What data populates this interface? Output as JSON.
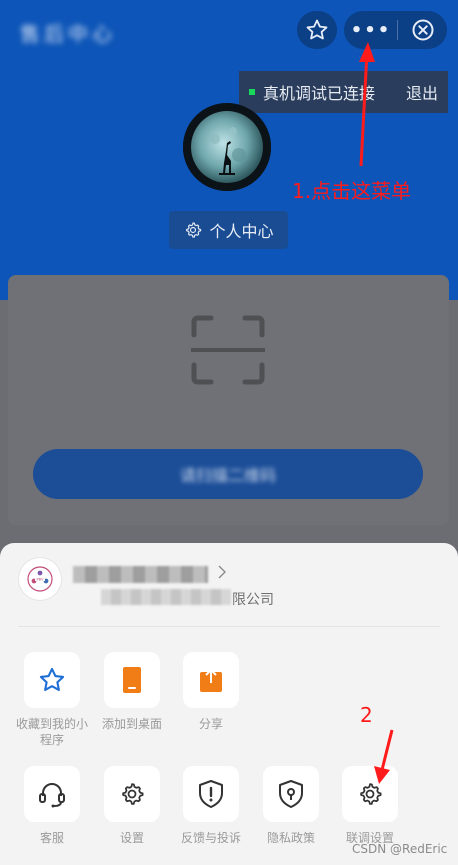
{
  "header": {
    "title": "售后中心",
    "debug_status": "真机调试已连接",
    "debug_exit": "退出",
    "capsule_more": "•••",
    "profile_button": "个人中心"
  },
  "card": {
    "scan_button": "请扫描二维码"
  },
  "sheet": {
    "mini_program_name": "",
    "company_suffix": "限公司",
    "row1": [
      {
        "label": "收藏到我的小程序",
        "icon": "star-icon"
      },
      {
        "label": "添加到桌面",
        "icon": "phone-icon"
      },
      {
        "label": "分享",
        "icon": "share-icon"
      }
    ],
    "row2": [
      {
        "label": "客服",
        "icon": "headset-icon"
      },
      {
        "label": "设置",
        "icon": "gear-icon"
      },
      {
        "label": "反馈与投诉",
        "icon": "warning-shield-icon"
      },
      {
        "label": "隐私政策",
        "icon": "privacy-shield-icon"
      },
      {
        "label": "联调设置",
        "icon": "gear-icon"
      }
    ]
  },
  "annotations": {
    "step1": "1.点击这菜单",
    "step2": "2"
  },
  "watermark": "CSDN @RedEric",
  "colors": {
    "brand_blue": "#0d55b8",
    "annotation_red": "#ff1b1b",
    "accent_orange": "#f07d16",
    "accent_blue": "#1f6fd6"
  }
}
